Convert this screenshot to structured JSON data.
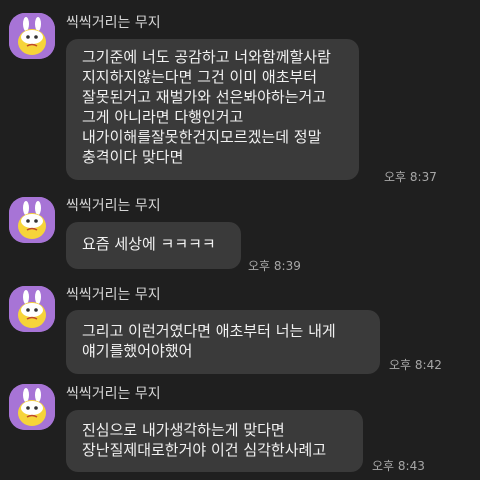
{
  "messages": [
    {
      "sender": "씩씩거리는 무지",
      "lines": [
        "그기준에 너도 공감하고 너와함께할사람",
        "지지하지않는다면 그건 이미 애초부터",
        "잘못된거고 재벌가와 선은봐야하는거고",
        "그게 아니라면 다행인거고",
        "내가이해를잘못한건지모르겠는데 정말",
        "충격이다 맞다면"
      ],
      "time": "오후 8:37"
    },
    {
      "sender": "씩씩거리는 무지",
      "lines": [
        "요즘 세상에 ㅋㅋㅋㅋ"
      ],
      "time": "오후 8:39"
    },
    {
      "sender": "씩씩거리는 무지",
      "lines": [
        "그리고 이런거였다면 애초부터 너는 내게",
        "얘기를했어야했어"
      ],
      "time": "오후 8:42"
    },
    {
      "sender": "씩씩거리는 무지",
      "lines": [
        "진심으로 내가생각하는게 맞다면",
        "장난질제대로한거야 이건 심각한사례고"
      ],
      "time": "오후 8:43"
    }
  ],
  "colors": {
    "background": "#1f1f1f",
    "bubble": "#3a3a3a",
    "avatar": "#a774d6"
  },
  "icons": {
    "avatar": "muzi-character-icon"
  }
}
